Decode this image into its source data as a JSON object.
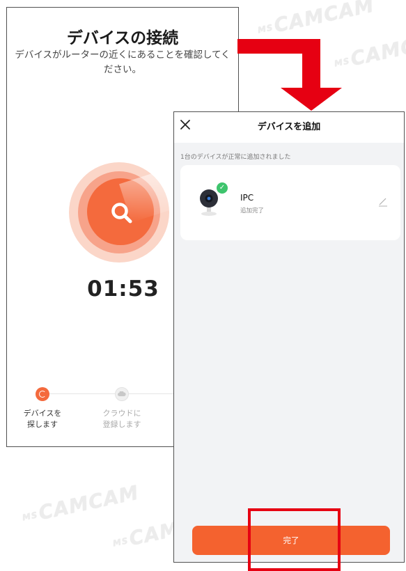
{
  "watermarks": {
    "items": [
      {
        "prefix": "MS",
        "text": "CAMCAM"
      },
      {
        "prefix": "MS",
        "text": "CAMCAM"
      },
      {
        "prefix": "MS",
        "text": "CAMCAM"
      },
      {
        "prefix": "MS",
        "text": "CAMCAM"
      }
    ]
  },
  "connect_screen": {
    "title": "デバイスの接続",
    "subtitle": "デバイスがルーターの近くにあることを確認してください。",
    "timer": "01:53",
    "steps": [
      {
        "label": "デバイスを\n探します",
        "state": "active"
      },
      {
        "label": "クラウドに\n登録します",
        "state": "pending"
      }
    ],
    "colors": {
      "accent": "#f46a3d"
    }
  },
  "add_screen": {
    "title": "デバイスを追加",
    "info": "1台のデバイスが正常に追加されました",
    "device": {
      "name": "IPC",
      "status": "追加完了",
      "icon": "camera-icon"
    },
    "done_label": "完了",
    "colors": {
      "button": "#f4622f",
      "check": "#3ec46d"
    }
  },
  "annotation": {
    "color": "#e60012"
  }
}
